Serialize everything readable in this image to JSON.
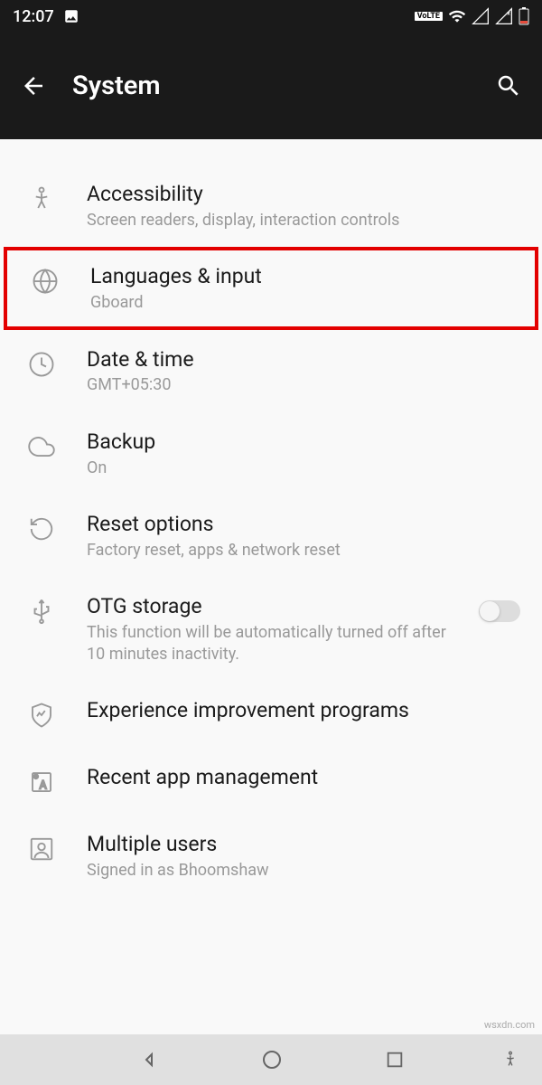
{
  "status_bar": {
    "time": "12:07",
    "volte_label": "VoLTE"
  },
  "header": {
    "title": "System"
  },
  "settings": [
    {
      "title": "Accessibility",
      "subtitle": "Screen readers, display, interaction controls"
    },
    {
      "title": "Languages & input",
      "subtitle": "Gboard"
    },
    {
      "title": "Date & time",
      "subtitle": "GMT+05:30"
    },
    {
      "title": "Backup",
      "subtitle": "On"
    },
    {
      "title": "Reset options",
      "subtitle": "Factory reset, apps & network reset"
    },
    {
      "title": "OTG storage",
      "subtitle": "This function will be automatically turned off after 10 minutes inactivity."
    },
    {
      "title": "Experience improvement programs",
      "subtitle": ""
    },
    {
      "title": "Recent app management",
      "subtitle": ""
    },
    {
      "title": "Multiple users",
      "subtitle": "Signed in as Bhoomshaw"
    }
  ],
  "watermark": "wsxdn.com"
}
